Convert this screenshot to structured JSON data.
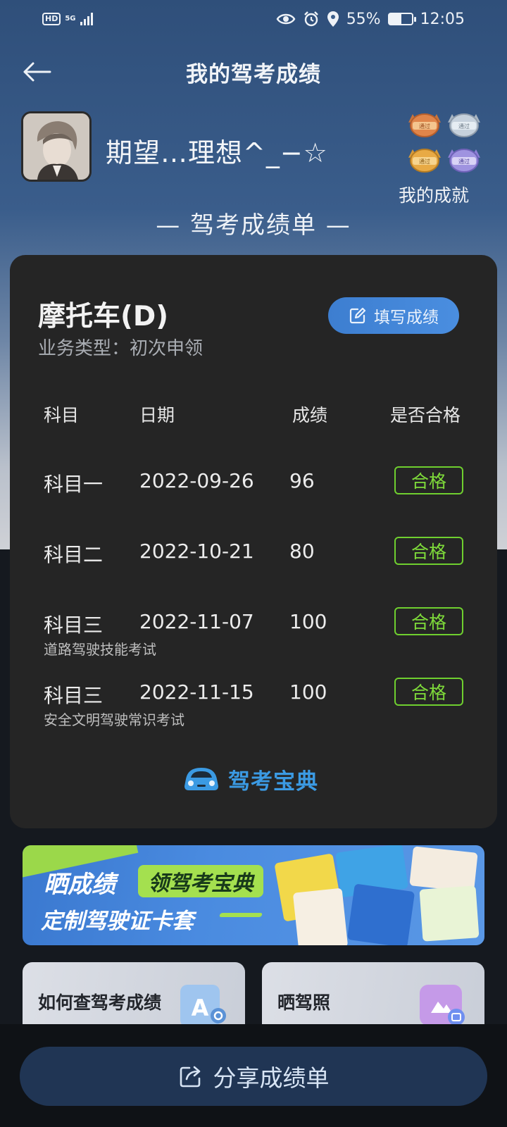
{
  "status_bar": {
    "hd": "HD",
    "network": "5G",
    "battery_percent": "55%",
    "battery_level": 0.55,
    "time": "12:05"
  },
  "header": {
    "title": "我的驾考成绩"
  },
  "profile": {
    "username": "期望…理想^_−☆",
    "medal_text": "通过",
    "achievements_label": "我的成就"
  },
  "report_title": "— 驾考成绩单 —",
  "card": {
    "vehicle_type": "摩托车(D)",
    "business_type": "业务类型：初次申领",
    "fill_button_label": "填写成绩",
    "columns": [
      "科目",
      "日期",
      "成绩",
      "是否合格"
    ],
    "rows": [
      {
        "subject": "科目一",
        "date": "2022-09-26",
        "score": "96",
        "result": "合格",
        "note": ""
      },
      {
        "subject": "科目二",
        "date": "2022-10-21",
        "score": "80",
        "result": "合格",
        "note": ""
      },
      {
        "subject": "科目三",
        "date": "2022-11-07",
        "score": "100",
        "result": "合格",
        "note": "道路驾驶技能考试"
      },
      {
        "subject": "科目三",
        "date": "2022-11-15",
        "score": "100",
        "result": "合格",
        "note": "安全文明驾驶常识考试"
      }
    ],
    "brand": "驾考宝典"
  },
  "banner": {
    "line1": "晒成绩",
    "pill": "领驾考宝典",
    "line2": "定制驾驶证卡套"
  },
  "cards": {
    "left_label": "如何查驾考成绩",
    "right_label": "晒驾照"
  },
  "share_button_label": "分享成绩单",
  "colors": {
    "accent_blue": "#4a8ee0",
    "pass_green": "#7fdc3a",
    "brand_blue": "#3b9ae3",
    "card_bg": "#252525"
  }
}
